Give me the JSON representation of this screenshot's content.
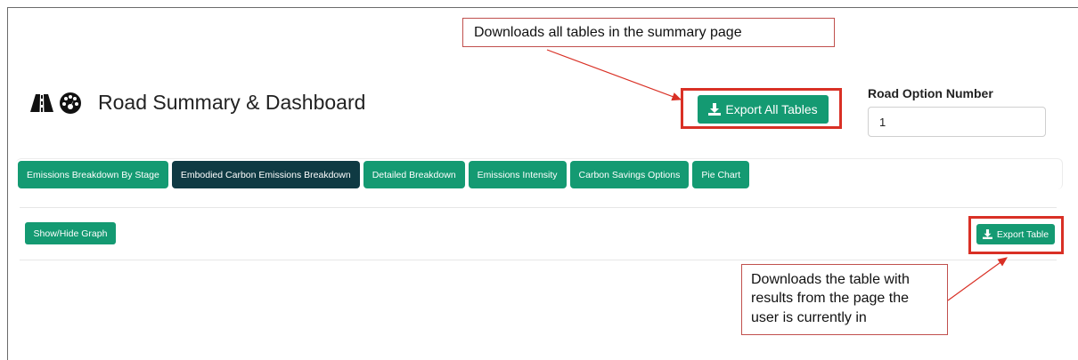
{
  "header": {
    "title": "Road Summary & Dashboard",
    "icons": [
      "road-icon",
      "dashboard-gauge-icon"
    ]
  },
  "export_all": {
    "label": "Export All Tables",
    "icon": "download-icon"
  },
  "road_option": {
    "label": "Road Option Number",
    "value": "1"
  },
  "tabs": [
    {
      "label": "Emissions Breakdown By Stage",
      "active": false
    },
    {
      "label": "Embodied Carbon Emissions Breakdown",
      "active": true
    },
    {
      "label": "Detailed Breakdown",
      "active": false
    },
    {
      "label": "Emissions Intensity",
      "active": false
    },
    {
      "label": "Carbon Savings Options",
      "active": false
    },
    {
      "label": "Pie Chart",
      "active": false
    }
  ],
  "panel": {
    "show_hide_label": "Show/Hide Graph",
    "export_table_label": "Export Table"
  },
  "annotations": {
    "export_all_note": "Downloads all tables in the summary page",
    "export_table_note": [
      "Downloads the table with",
      "results from the page the",
      "user is currently in"
    ],
    "highlight_color": "#d93025"
  },
  "colors": {
    "accent": "#149a72",
    "active_tab": "#0f3a43"
  }
}
